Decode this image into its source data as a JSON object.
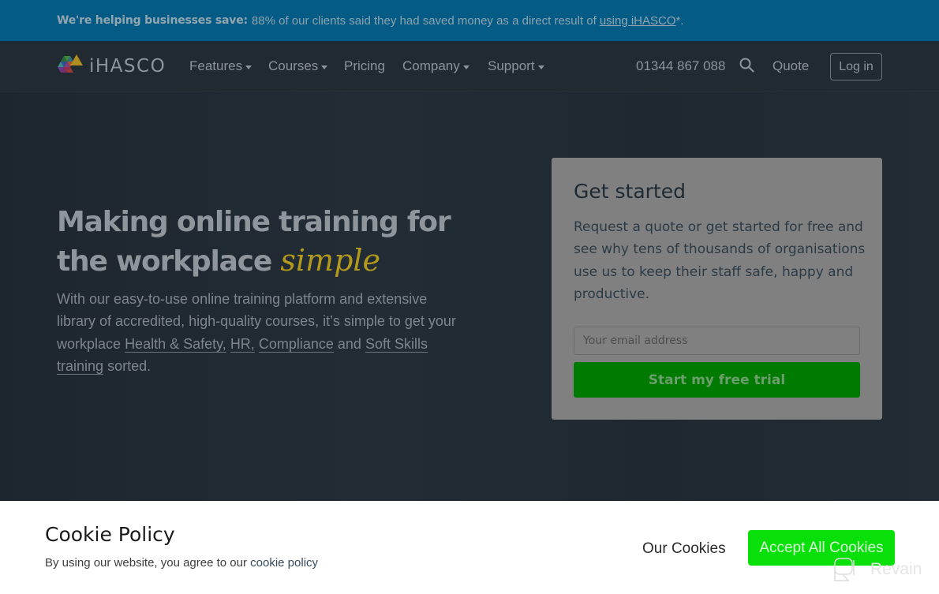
{
  "announcement": {
    "bold": "We're helping businesses save:",
    "text": "88% of our clients said they had saved money as a direct result of",
    "link": "using iHASCO",
    "suffix": "*."
  },
  "navbar": {
    "brand": "iHASCO",
    "items": [
      {
        "label": "Features",
        "dropdown": true
      },
      {
        "label": "Courses",
        "dropdown": true
      },
      {
        "label": "Pricing",
        "dropdown": false
      },
      {
        "label": "Company",
        "dropdown": true
      },
      {
        "label": "Support",
        "dropdown": true
      }
    ],
    "phone": "01344 867 088",
    "search_icon": "search-icon",
    "quote": "Quote",
    "login": "Log in"
  },
  "hero": {
    "headline_line1": "Making online training for",
    "headline_line2": "the workplace",
    "headline_script": "simple",
    "lead_start": "With our easy-to-use online training platform and extensive library of accredited, high-quality courses, it’s simple to get your workplace",
    "links": [
      "Health & Safety,",
      "HR,",
      "Compliance",
      "Soft Skills training"
    ],
    "lead_and": "and",
    "lead_end": "sorted."
  },
  "signup_card": {
    "title": "Get started",
    "body": "Request a quote or get started for free and see why tens of thousands of organisations use us to keep their staff safe, happy and productive.",
    "email_placeholder": "Your email address",
    "email_value": "",
    "cta": "Start my free trial"
  },
  "cookie_banner": {
    "title": "Cookie Policy",
    "text": "By using our website, you agree to our",
    "link": "cookie policy",
    "our_cookies": "Our Cookies",
    "accept": "Accept All Cookies"
  },
  "watermark": {
    "text": "Revain"
  },
  "colors": {
    "announcement_bg": "#045c86",
    "navbar_bg": "#212931",
    "script_accent": "#b39a1d",
    "trial_button": "#007a00",
    "accept_button": "#09e009"
  }
}
